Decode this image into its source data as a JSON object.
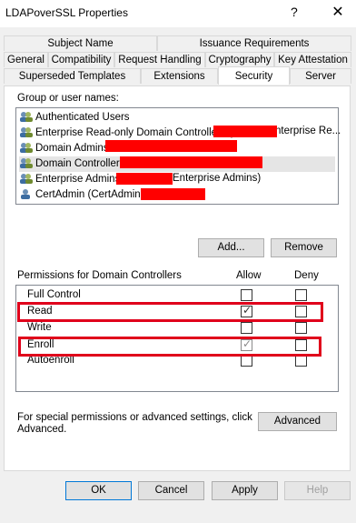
{
  "window": {
    "title": "LDAPoverSSL Properties",
    "help": "?",
    "close": "✕"
  },
  "tabs_row1": [
    "Subject Name",
    "Issuance Requirements"
  ],
  "tabs_row2": [
    "General",
    "Compatibility",
    "Request Handling",
    "Cryptography",
    "Key Attestation"
  ],
  "tabs_row3": [
    "Superseded Templates",
    "Extensions",
    "Security",
    "Server"
  ],
  "selected_tab": "Security",
  "group_label": "Group or user names:",
  "users": [
    "Authenticated Users",
    "Enterprise Read-only Domain Controllers (",
    "nterprise Re...",
    "Domain Admins",
    "Domain Controllers",
    "Enterprise Admins",
    "Enterprise Admins)",
    "CertAdmin (CertAdmin@"
  ],
  "add_button": "Add...",
  "remove_button": "Remove",
  "permissions_label": "Permissions for Domain Controllers",
  "allow_label": "Allow",
  "deny_label": "Deny",
  "permissions": [
    {
      "name": "Full Control",
      "allow": false,
      "deny": false
    },
    {
      "name": "Read",
      "allow": true,
      "deny": false
    },
    {
      "name": "Write",
      "allow": false,
      "deny": false
    },
    {
      "name": "Enroll",
      "allow": true,
      "deny": false
    },
    {
      "name": "Autoenroll",
      "allow": false,
      "deny": false
    }
  ],
  "special_text_1": "For special permissions or advanced settings, click",
  "special_text_2": "Advanced.",
  "advanced_button": "Advanced",
  "ok_button": "OK",
  "cancel_button": "Cancel",
  "apply_button": "Apply",
  "help_button": "Help",
  "colors": {
    "highlight": "#e0001b",
    "redaction": "#ff0000",
    "focus": "#0078d7"
  }
}
